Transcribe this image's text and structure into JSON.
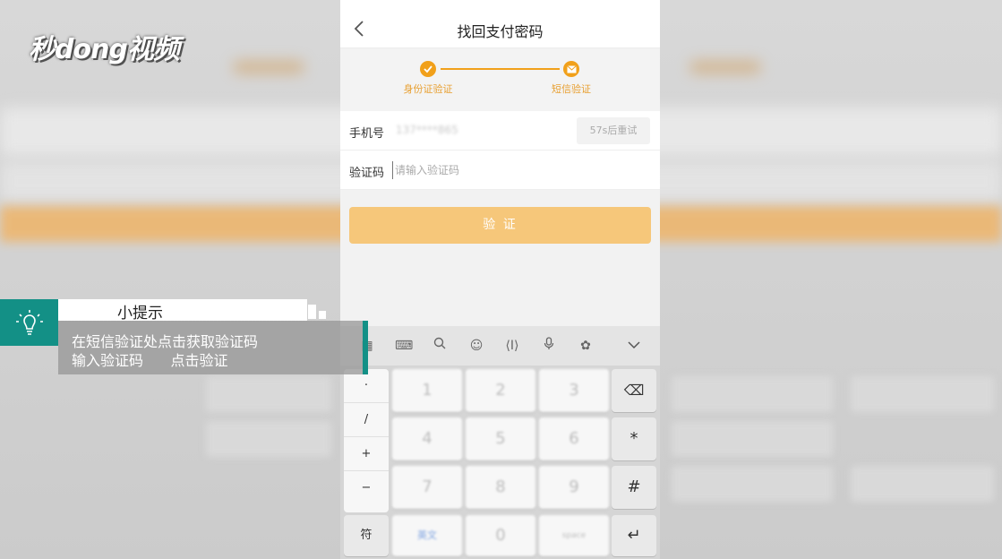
{
  "logo_text": "秒dong视频",
  "nav": {
    "title": "找回支付密码"
  },
  "steps": [
    {
      "label": "身份证验证",
      "state": "done",
      "icon": "check-icon"
    },
    {
      "label": "短信验证",
      "state": "active",
      "icon": "mail-icon"
    }
  ],
  "form": {
    "phone_label": "手机号",
    "phone_value": "137****865",
    "retry_label": "57s后重试",
    "code_label": "验证码",
    "code_placeholder": "请输入验证码"
  },
  "verify_label": "验 证",
  "keyboard": {
    "toolbar_icons": [
      "grid-icon",
      "keyboard-icon",
      "search-icon",
      "emoji-icon",
      "cursor-icon",
      "mic-icon",
      "skin-icon",
      "collapse-icon"
    ],
    "side_keys": [
      "·",
      "/",
      "+",
      "−"
    ],
    "symbol_key": "符",
    "digits": [
      "1",
      "2",
      "3",
      "4",
      "5",
      "6",
      "7",
      "8",
      "9",
      "0"
    ],
    "switch_key": "英文",
    "space_key": "space",
    "right_keys": [
      "⌫",
      "*",
      "#",
      "↵"
    ]
  },
  "tip": {
    "title": "小提示",
    "line1": "在短信验证处点击获取验证码",
    "line2": "输入验证码      点击验证"
  },
  "colors": {
    "accent": "#f1a01a",
    "button": "#f6c77a",
    "tip_teal": "#139086"
  }
}
